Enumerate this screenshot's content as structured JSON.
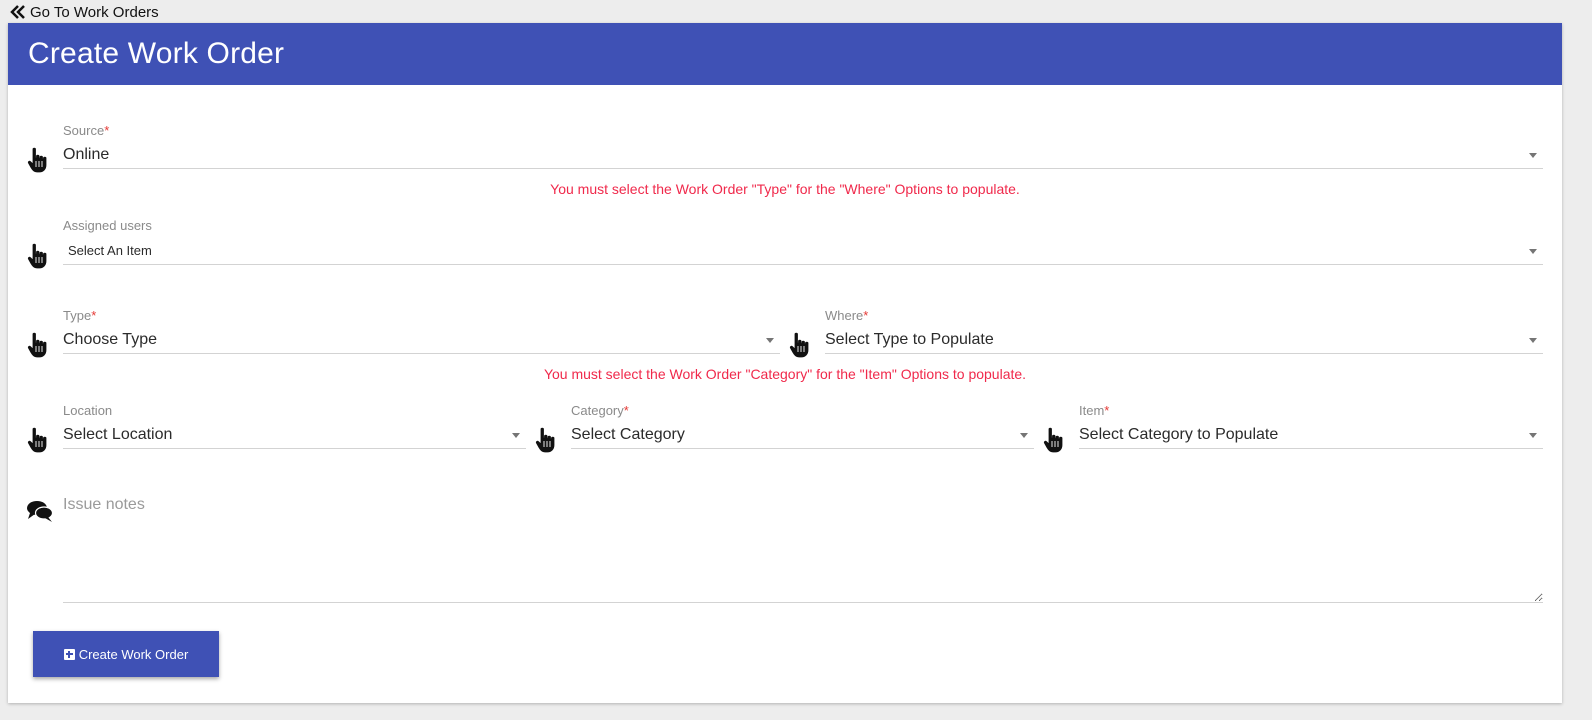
{
  "nav": {
    "back_label": "Go To Work Orders"
  },
  "header": {
    "title": "Create Work Order"
  },
  "form": {
    "source": {
      "label": "Source",
      "required_mark": "*",
      "value": "Online"
    },
    "type_warning": "You must select the Work Order \"Type\" for the \"Where\" Options to populate.",
    "assigned_users": {
      "label": "Assigned users",
      "value": "Select An Item"
    },
    "type": {
      "label": "Type",
      "required_mark": "*",
      "value": "Choose Type"
    },
    "where": {
      "label": "Where",
      "required_mark": "*",
      "value": "Select Type to Populate"
    },
    "category_warning": "You must select the Work Order \"Category\" for the \"Item\" Options to populate.",
    "location": {
      "label": "Location",
      "value": "Select Location"
    },
    "category": {
      "label": "Category",
      "required_mark": "*",
      "value": "Select Category"
    },
    "item": {
      "label": "Item",
      "required_mark": "*",
      "value": "Select Category to Populate"
    },
    "notes": {
      "placeholder": "Issue notes"
    },
    "submit_label": "Create Work Order"
  },
  "colors": {
    "primary": "#3f51b5",
    "warning": "#f0294b",
    "required": "#e53935",
    "background": "#ededed"
  },
  "icons": {
    "back": "double-chevron-left-icon",
    "field": "hand-pointer-icon",
    "notes": "chat-bubbles-icon",
    "submit": "plus-square-icon"
  }
}
